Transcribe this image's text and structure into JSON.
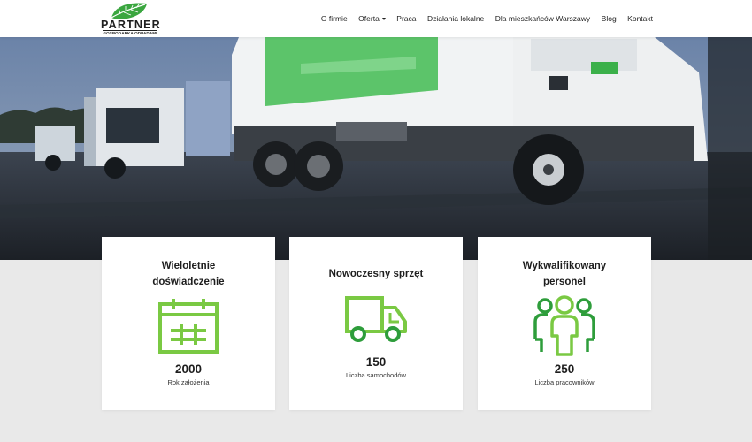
{
  "brand": {
    "name": "PARTNER",
    "tagline": "GOSPODARKA ODPADAMI"
  },
  "nav": {
    "items": [
      {
        "label": "O firmie"
      },
      {
        "label": "Oferta",
        "has_dropdown": true
      },
      {
        "label": "Praca"
      },
      {
        "label": "Działania lokalne"
      },
      {
        "label": "Dla mieszkańców Warszawy"
      },
      {
        "label": "Blog"
      },
      {
        "label": "Kontakt"
      }
    ]
  },
  "hero": {
    "image": "garbage-trucks-photo"
  },
  "features": [
    {
      "title_line1": "Wieloletnie",
      "title_line2": "doświadczenie",
      "icon": "calendar-icon",
      "value": "2000",
      "label": "Rok założenia"
    },
    {
      "title_line1": "Nowoczesny sprzęt",
      "title_line2": "",
      "icon": "truck-icon",
      "value": "150",
      "label": "Liczba samochodów"
    },
    {
      "title_line1": "Wykwalifikowany",
      "title_line2": "personel",
      "icon": "team-icon",
      "value": "250",
      "label": "Liczba pracowników"
    }
  ],
  "colors": {
    "accent_green": "#7ac943",
    "dark_green": "#2e9d3b",
    "header_bg": "#ffffff",
    "page_bg": "#e9e9e9"
  }
}
